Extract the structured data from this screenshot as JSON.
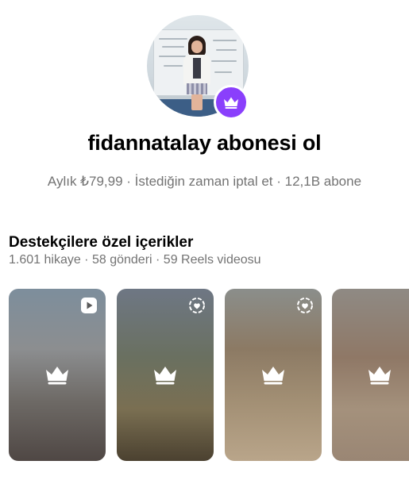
{
  "profile": {
    "title": "fidannatalay abonesi ol",
    "subtitle": "Aylık ₺79,99 · İstediğin zaman iptal et · 12,1B abone"
  },
  "section": {
    "title": "Destekçilere özel içerikler",
    "meta": "1.601 hikaye · 58 gönderi · 59 Reels videosu"
  },
  "cards": [
    {
      "type_icon": "reels-icon",
      "locked_icon": "crown-icon"
    },
    {
      "type_icon": "story-highlight-icon",
      "locked_icon": "crown-icon"
    },
    {
      "type_icon": "story-highlight-icon",
      "locked_icon": "crown-icon"
    },
    {
      "type_icon": "",
      "locked_icon": "crown-icon"
    }
  ],
  "colors": {
    "badge": "#8a3ffc",
    "secondary_text": "#737373"
  }
}
